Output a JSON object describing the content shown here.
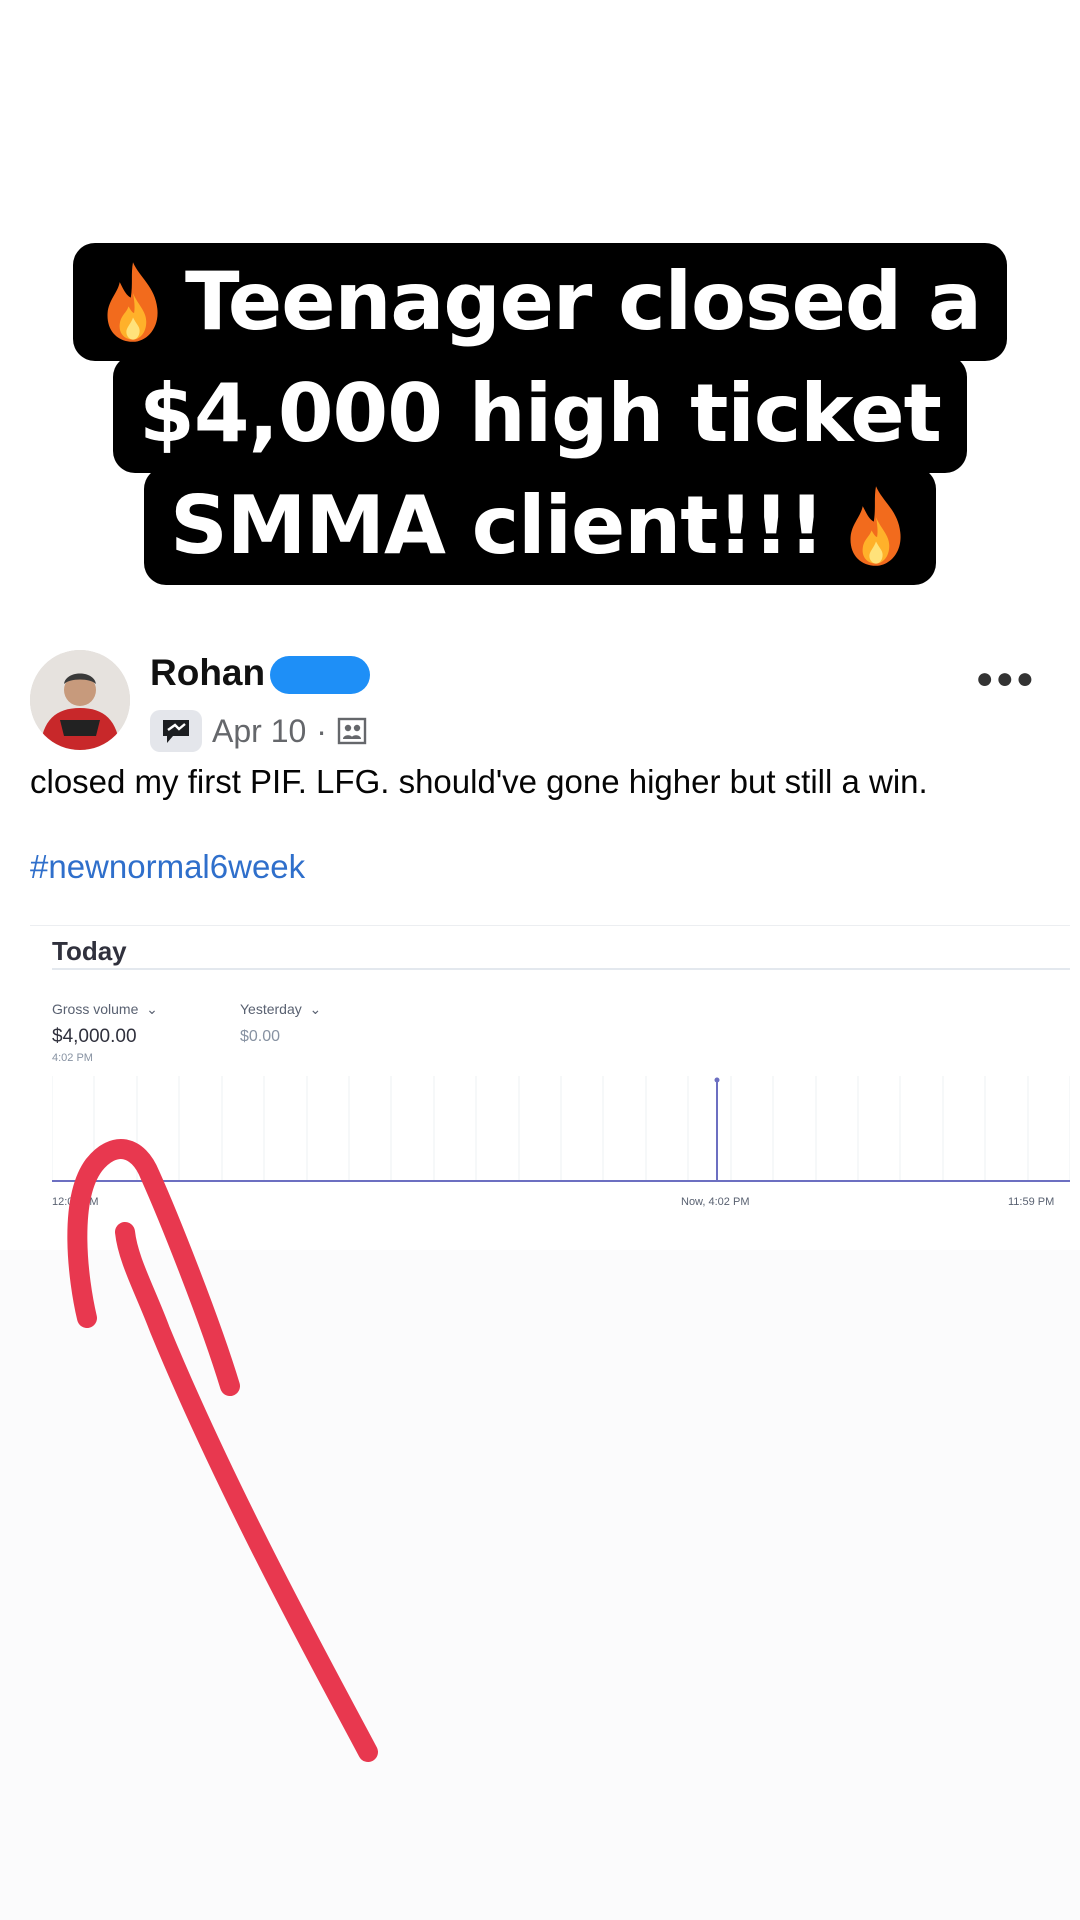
{
  "caption": {
    "lines": [
      "Teenager closed a",
      "$4,000 high ticket",
      "SMMA client!!!"
    ],
    "emoji": "fire-emoji",
    "background": "#000000",
    "text_color": "#ffffff"
  },
  "post": {
    "author": "Rohan",
    "date": "Apr 10",
    "separator": "·",
    "more_icon": "more-dots-icon",
    "text": "closed my first PIF. LFG. should've gone higher but still a win.",
    "hashtag": "#newnormal6week",
    "hashtag_color": "#2f6fcb",
    "redaction_color": "#1e8ff7"
  },
  "dashboard": {
    "title": "Today",
    "gross_volume_label": "Gross volume",
    "gross_volume_value": "$4,000.00",
    "gross_volume_time": "4:02 PM",
    "compare_label": "Yesterday",
    "compare_value": "$0.00",
    "axis_start": "12:00 AM",
    "axis_now": "Now, 4:02 PM",
    "axis_end": "11:59 PM",
    "line_color": "#6c6fc1"
  },
  "annotation": {
    "arrow_color": "#e8384f"
  }
}
